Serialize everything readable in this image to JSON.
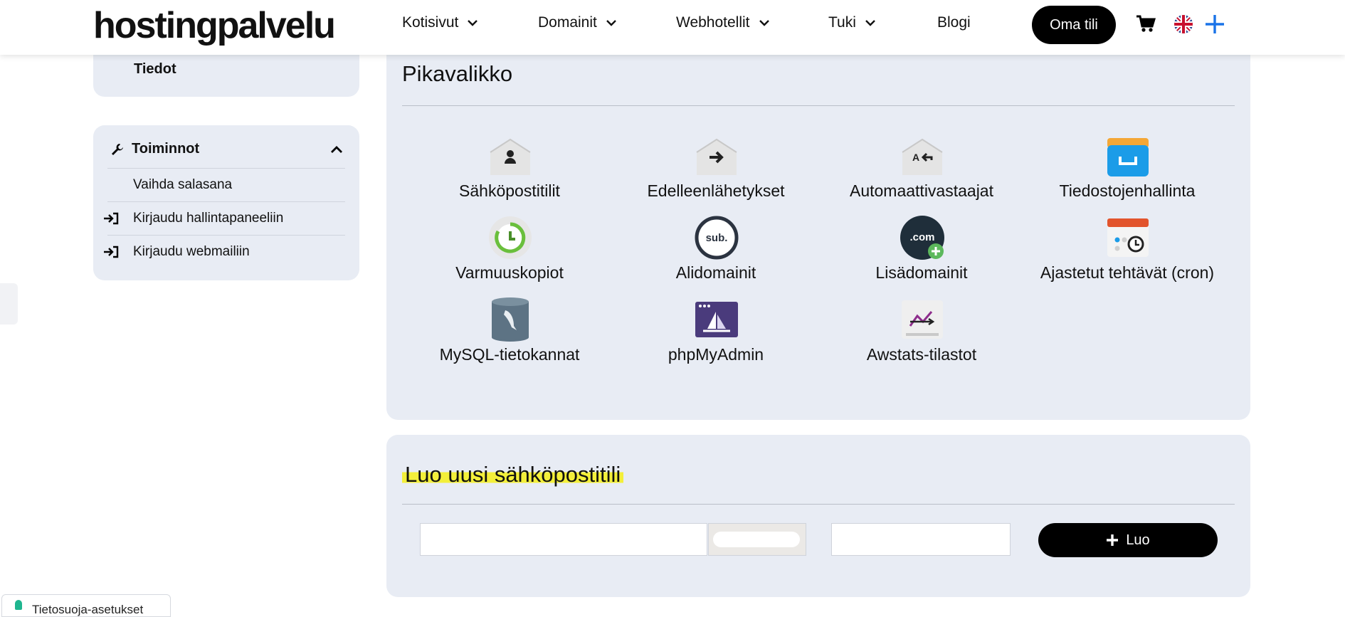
{
  "header": {
    "logo": "hostingpalvelu",
    "nav": [
      {
        "label": "Kotisivut",
        "has_dropdown": true
      },
      {
        "label": "Domainit",
        "has_dropdown": true
      },
      {
        "label": "Webhotellit",
        "has_dropdown": true
      },
      {
        "label": "Tuki",
        "has_dropdown": true
      },
      {
        "label": "Blogi",
        "has_dropdown": false
      }
    ],
    "account_button": "Oma tili",
    "icons": [
      "cart-icon",
      "uk-flag-icon",
      "plus-icon"
    ],
    "accent_color": "#1a73e8"
  },
  "sidebar": {
    "info_label": "Tiedot",
    "actions": {
      "title": "Toiminnot",
      "items": [
        {
          "label": "Vaihda salasana",
          "icon": ""
        },
        {
          "label": "Kirjaudu hallintapaneeliin",
          "icon": "login-icon"
        },
        {
          "label": "Kirjaudu webmailiin",
          "icon": "login-icon"
        }
      ]
    }
  },
  "quick_menu": {
    "title": "Pikavalikko",
    "items": [
      {
        "label": "Sähköpostitilit",
        "icon": "email-account-icon"
      },
      {
        "label": "Edelleenlähetykset",
        "icon": "email-forward-icon"
      },
      {
        "label": "Automaattivastaajat",
        "icon": "autoresponder-icon"
      },
      {
        "label": "Tiedostojenhallinta",
        "icon": "file-manager-icon"
      },
      {
        "label": "Varmuuskopiot",
        "icon": "backup-icon"
      },
      {
        "label": "Alidomainit",
        "icon": "subdomain-icon"
      },
      {
        "label": "Lisädomainit",
        "icon": "addon-domain-icon"
      },
      {
        "label": "Ajastetut tehtävät (cron)",
        "icon": "cron-jobs-icon"
      },
      {
        "label": "MySQL-tietokannat",
        "icon": "mysql-database-icon"
      },
      {
        "label": "phpMyAdmin",
        "icon": "phpmyadmin-icon"
      },
      {
        "label": "Awstats-tilastot",
        "icon": "awstats-icon"
      }
    ]
  },
  "create_email": {
    "title": "Luo uusi sähköpostitili",
    "submit_label": "Luo",
    "highlight_color": "#f3ef3a"
  },
  "privacy_banner": {
    "label": "Tietosuoja-asetukset",
    "color": "#1fb58f"
  }
}
